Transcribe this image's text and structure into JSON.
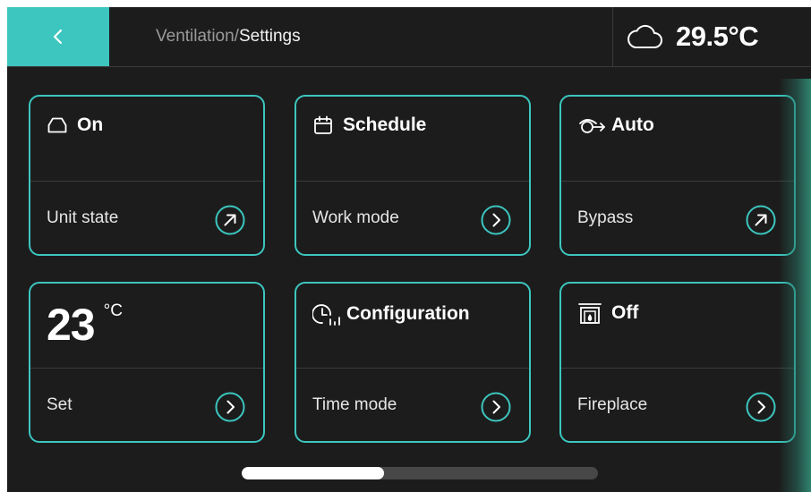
{
  "header": {
    "breadcrumb_parent": "Ventilation/",
    "breadcrumb_current": "Settings",
    "back_icon": "chevron-left-icon",
    "weather_icon": "cloud-icon",
    "outdoor_temp": "29.5°C"
  },
  "tiles": [
    {
      "name": "unit-state",
      "icon": "unit-icon",
      "value": "On",
      "label": "Unit state",
      "action_icon": "arrow-up-right-icon"
    },
    {
      "name": "work-mode",
      "icon": "calendar-icon",
      "value": "Schedule",
      "label": "Work mode",
      "action_icon": "chevron-right-icon"
    },
    {
      "name": "bypass",
      "icon": "bypass-icon",
      "value": "Auto",
      "label": "Bypass",
      "action_icon": "arrow-up-right-icon"
    },
    {
      "name": "set-temp",
      "value": "23",
      "unit": "°C",
      "label": "Set",
      "action_icon": "chevron-right-icon"
    },
    {
      "name": "time-mode",
      "icon": "clock-bars-icon",
      "value": "Configuration",
      "label": "Time mode",
      "action_icon": "chevron-right-icon"
    },
    {
      "name": "fireplace",
      "icon": "fireplace-icon",
      "value": "Off",
      "label": "Fireplace",
      "action_icon": "chevron-right-icon"
    }
  ],
  "scroll": {
    "position_fraction": 0.4
  },
  "colors": {
    "accent": "#3cc6bf",
    "background": "#1c1c1c",
    "text": "#ffffff"
  }
}
